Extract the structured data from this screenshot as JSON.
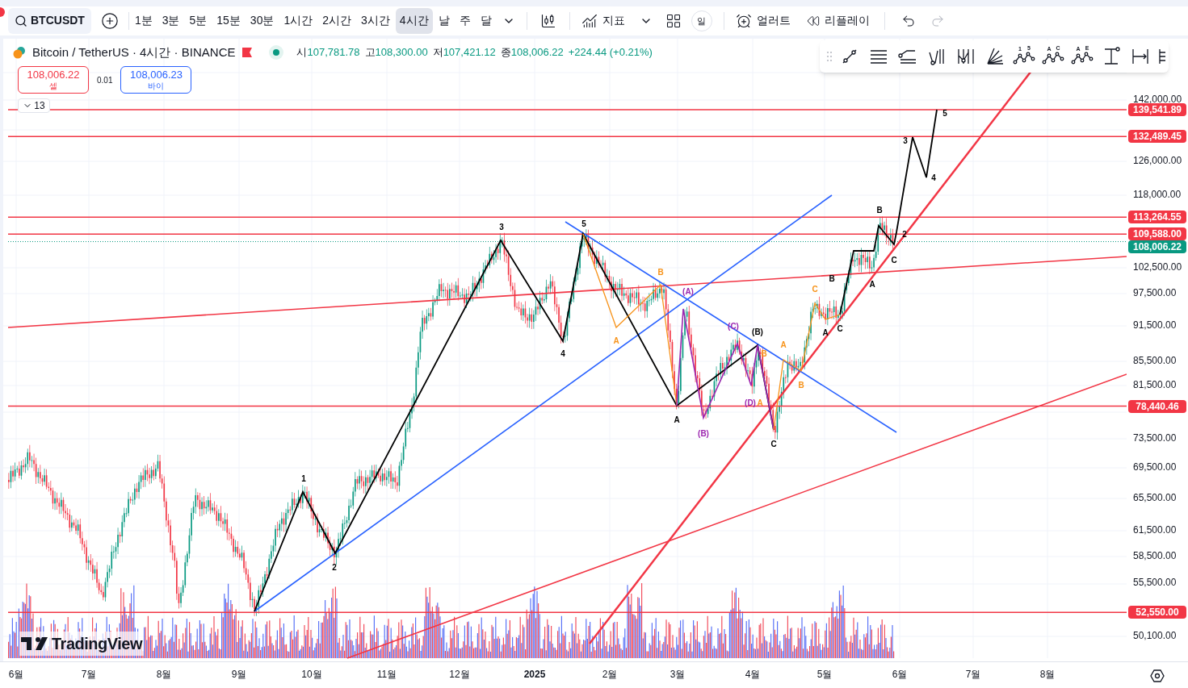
{
  "toolbar": {
    "symbol": "BTCUSDT",
    "intervals": [
      {
        "label": "1분",
        "selected": false
      },
      {
        "label": "3분",
        "selected": false
      },
      {
        "label": "5분",
        "selected": false
      },
      {
        "label": "15분",
        "selected": false
      },
      {
        "label": "30분",
        "selected": false
      },
      {
        "label": "1시간",
        "selected": false
      },
      {
        "label": "2시간",
        "selected": false
      },
      {
        "label": "3시간",
        "selected": false
      },
      {
        "label": "4시간",
        "selected": true
      },
      {
        "label": "날",
        "selected": false
      },
      {
        "label": "주",
        "selected": false
      },
      {
        "label": "달",
        "selected": false
      }
    ],
    "indicators": "지표",
    "session_badge": "일",
    "alert": "얼러트",
    "replay": "리플레이"
  },
  "legend": {
    "title": "Bitcoin / TetherUS · 4시간 · BINANCE",
    "ohlc": [
      {
        "label": "시",
        "value": "107,781.78"
      },
      {
        "label": "고",
        "value": "108,300.00"
      },
      {
        "label": "저",
        "value": "107,421.12"
      },
      {
        "label": "종",
        "value": "108,006.22"
      }
    ],
    "change": "+224.44 (+0.21%)",
    "sell": {
      "price": "108,006.22",
      "label": "셀"
    },
    "spread": "0.01",
    "buy": {
      "price": "108,006.23",
      "label": "바이"
    },
    "collapsed_count": "13"
  },
  "drawing_tools": [
    {
      "kind": "trend"
    },
    {
      "kind": "parallel"
    },
    {
      "kind": "regression"
    },
    {
      "kind": "pitch"
    },
    {
      "kind": "pitchfork"
    },
    {
      "kind": "fan"
    },
    {
      "kind": "wave",
      "marks": [
        "1",
        "5"
      ]
    },
    {
      "kind": "wave",
      "marks": [
        "A",
        "C"
      ]
    },
    {
      "kind": "wave",
      "marks": [
        "A",
        "E"
      ]
    },
    {
      "kind": "price-range"
    },
    {
      "kind": "date-range"
    },
    {
      "kind": "more"
    }
  ],
  "price_axis": {
    "ticks": [
      "142,000.00",
      "126,000.00",
      "118,000.00",
      "102,500.00",
      "97,500.00",
      "91,500.00",
      "85,500.00",
      "81,500.00",
      "73,500.00",
      "69,500.00",
      "65,500.00",
      "61,500.00",
      "58,500.00",
      "55,500.00",
      "50,100.00"
    ],
    "tags": [
      {
        "value": "139,541.89",
        "color": "#f23645"
      },
      {
        "value": "132,489.45",
        "color": "#f23645"
      },
      {
        "value": "113,264.55",
        "color": "#f23645"
      },
      {
        "value": "109,588.00",
        "color": "#f23645"
      },
      {
        "value": "108,006.22",
        "color": "#089981"
      },
      {
        "value": "78,440.46",
        "color": "#f23645"
      },
      {
        "value": "52,550.00",
        "color": "#f23645"
      }
    ]
  },
  "time_axis": [
    {
      "label": "6월",
      "kind": "month"
    },
    {
      "label": "7월",
      "kind": "month"
    },
    {
      "label": "8월",
      "kind": "month"
    },
    {
      "label": "9월",
      "kind": "month"
    },
    {
      "label": "10월",
      "kind": "month"
    },
    {
      "label": "11월",
      "kind": "month"
    },
    {
      "label": "12월",
      "kind": "month"
    },
    {
      "label": "2025",
      "kind": "year"
    },
    {
      "label": "2월",
      "kind": "month"
    },
    {
      "label": "3월",
      "kind": "month"
    },
    {
      "label": "4월",
      "kind": "month"
    },
    {
      "label": "5월",
      "kind": "month"
    },
    {
      "label": "6월",
      "kind": "month"
    },
    {
      "label": "7월",
      "kind": "month"
    },
    {
      "label": "8월",
      "kind": "month"
    }
  ],
  "wave_labels": [
    {
      "text": "1",
      "color": "#000000"
    },
    {
      "text": "2",
      "color": "#000000"
    },
    {
      "text": "3",
      "color": "#000000"
    },
    {
      "text": "4",
      "color": "#000000"
    },
    {
      "text": "5",
      "color": "#000000"
    },
    {
      "text": "A",
      "color": "#000000"
    },
    {
      "text": "B",
      "color": "#f7931a"
    },
    {
      "text": "A",
      "color": "#f7931a"
    },
    {
      "text": "(A)",
      "color": "#9c27b0"
    },
    {
      "text": "(B)",
      "color": "#9c27b0"
    },
    {
      "text": "(C)",
      "color": "#9c27b0"
    },
    {
      "text": "(B)",
      "color": "#000000"
    },
    {
      "text": "(D)",
      "color": "#9c27b0"
    },
    {
      "text": "A",
      "color": "#f7931a"
    },
    {
      "text": "B",
      "color": "#f7931a"
    },
    {
      "text": "C",
      "color": "#000000"
    },
    {
      "text": "A",
      "color": "#f7931a"
    },
    {
      "text": "B",
      "color": "#f7931a"
    },
    {
      "text": "C",
      "color": "#f7931a"
    },
    {
      "text": "A",
      "color": "#000000"
    },
    {
      "text": "C",
      "color": "#000000"
    },
    {
      "text": "B",
      "color": "#000000"
    },
    {
      "text": "A",
      "color": "#000000"
    },
    {
      "text": "B",
      "color": "#000000"
    },
    {
      "text": "C",
      "color": "#000000"
    },
    {
      "text": "2",
      "color": "#000000"
    },
    {
      "text": "3",
      "color": "#000000"
    },
    {
      "text": "4",
      "color": "#000000"
    },
    {
      "text": "5",
      "color": "#000000"
    }
  ],
  "watermark_logo": "TradingView"
}
